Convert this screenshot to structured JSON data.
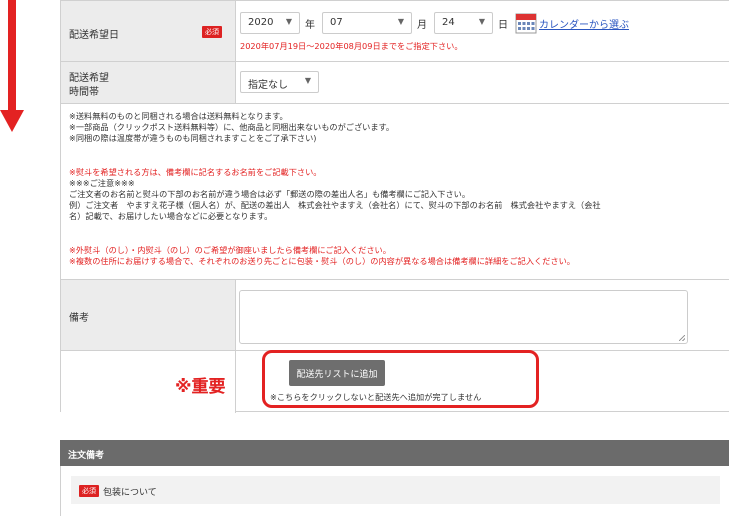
{
  "delivery_date": {
    "label": "配送希望日",
    "required_badge": "必須",
    "year": "2020",
    "year_unit": "年",
    "month": "07",
    "month_unit": "月",
    "day": "24",
    "day_unit": "日",
    "calendar_link": "カレンダーから選ぶ",
    "range_note": "2020年07月19日～2020年08月09日までをご指定下さい。"
  },
  "delivery_time": {
    "label_line1": "配送希望",
    "label_line2": "時間帯",
    "selected": "指定なし"
  },
  "notes": {
    "group1": [
      "※送料無料のものと同梱される場合は送料無料となります。",
      "※一部商品（クリックポスト送料無料等）に、他商品と同梱出来ないものがございます。",
      "※同梱の際は温度帯が違うものも同梱されますことをご了承下さい)"
    ],
    "group2_red": "※熨斗を希望される方は、備考欄に記名するお名前をご記載下さい。",
    "group2": [
      "※※※ご注意※※※",
      "ご注文者のお名前と熨斗の下部のお名前が違う場合は必ず「郵送の際の差出人名」も備考欄にご記入下さい。",
      "例）ご注文者　やますえ花子様（個人名）が、配送の差出人　株式会社やますえ（会社名）にて、熨斗の下部のお名前　株式会社やますえ（会社",
      "名）記載で、お届けしたい場合などに必要となります。"
    ],
    "group3_red": [
      "※外熨斗（のし）・内熨斗（のし）のご希望が御座いましたら備考欄にご記入ください。",
      "※複数の住所にお届けする場合で、それぞれのお送り先ごとに包装・熨斗（のし）の内容が異なる場合は備考欄に詳細をご記入ください。"
    ]
  },
  "remarks": {
    "label": "備考",
    "value": ""
  },
  "add_action": {
    "important_label": "※重要",
    "button_label": "配送先リストに追加",
    "button_note": "※こちらをクリックしないと配送先へ追加が完了しません"
  },
  "order_remarks": {
    "header": "注文備考",
    "required_badge": "必須",
    "packaging_label": "包装について"
  },
  "icons": {
    "arrow": "down-arrow-icon",
    "calendar": "calendar-icon",
    "dropdown": "chevron-down-icon"
  },
  "colors": {
    "accent_red": "#e32222",
    "label_bg": "#ececec",
    "section_header_bg": "#6b6b6b",
    "link": "#2a55c0"
  }
}
